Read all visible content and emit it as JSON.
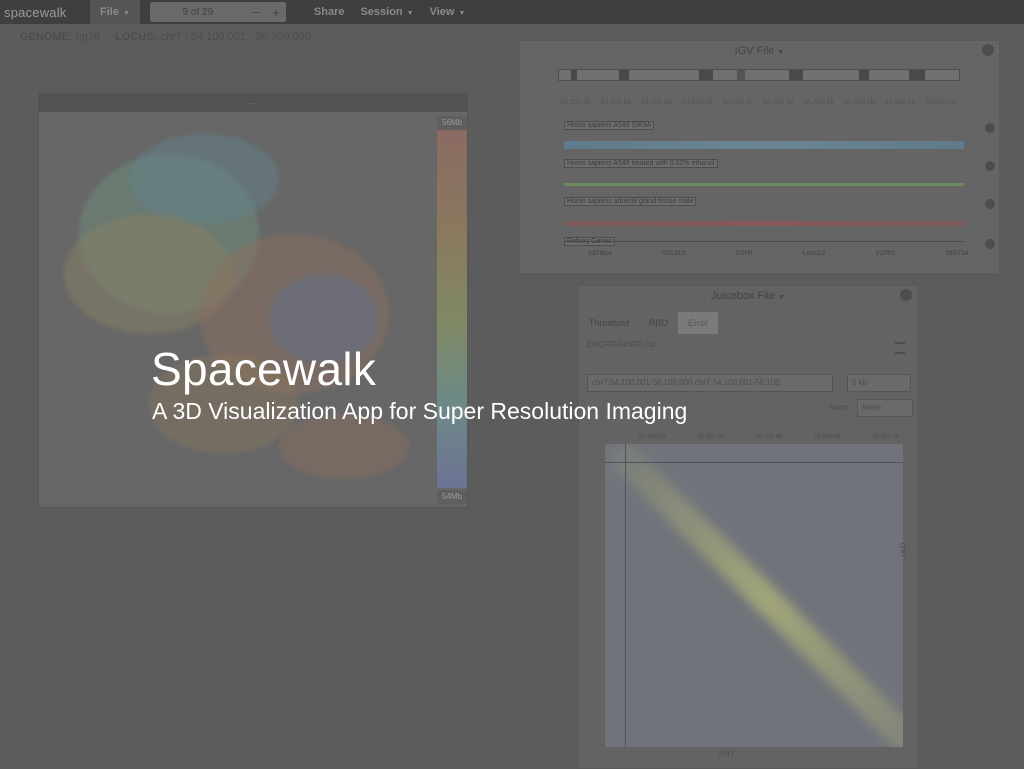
{
  "app": {
    "brand": "spacewalk"
  },
  "navbar": {
    "file_label": "File",
    "trace_value": "9 of 29",
    "decrement": "−",
    "increment": "+",
    "share_label": "Share",
    "session_label": "Session",
    "view_label": "View"
  },
  "genome_bar": {
    "genome_label": "GENOME:",
    "genome_value": "hg38",
    "locus_label": "LOCUS:",
    "locus_value": "chr7 : 54,100,001 - 56,300,000"
  },
  "panel_3d": {
    "colorbar_top": "56Mb",
    "colorbar_bottom": "54Mb"
  },
  "igv": {
    "title": "IGV File",
    "ruler_ticks": [
      "54,200 kb",
      "54,400 kb",
      "54,600 kb",
      "54,800 kb",
      "55,000 kb",
      "55,200 kb",
      "55,400 kb",
      "55,600 kb",
      "55,800 kb",
      "56,000 kb"
    ],
    "tracks": [
      "Homo sapiens A549 SIK3A",
      "Homo sapiens A549 treated with 0.02% ethanol",
      "Homo sapiens adrenal gland tissue male",
      "Refseq Genes"
    ],
    "genes": [
      "VSTM2A",
      "SEC61G",
      "EGFR",
      "LANCL2",
      "VOPP1",
      "SEPT14"
    ]
  },
  "juicebox": {
    "title": "Juicebox File",
    "tabs": [
      "Threshold",
      "RBD",
      "Error"
    ],
    "map_name": "ENCFF591NFR.hic",
    "locus_input": "chr7:54,100,001-56,100,000 chr7:54,100,001-56,100,",
    "resolution": "5 kb",
    "norm_label": "Norm",
    "norm_value": "None",
    "top_ticks": [
      "54,600 kb",
      "55,000 kb",
      "55,400 kb",
      "55,800 kb",
      "56,200 kb"
    ],
    "axis_bottom": "chr7",
    "axis_right": "chr7"
  },
  "overlay": {
    "title": "Spacewalk",
    "subtitle": "A 3D Visualization App for Super Resolution Imaging"
  },
  "colors": {
    "overlay_text": "#ffffff",
    "background": "#5c5c5c"
  }
}
